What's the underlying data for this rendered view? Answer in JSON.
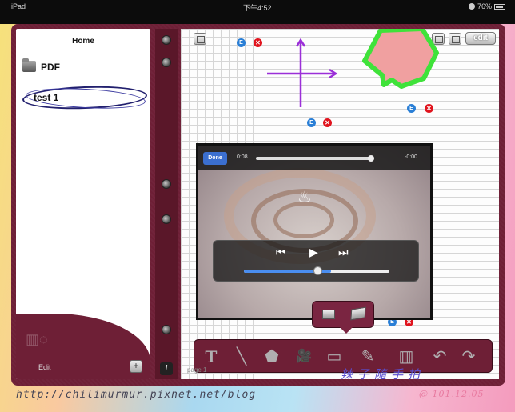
{
  "statusbar": {
    "device": "iPad",
    "time": "下午4:52",
    "battery": "76%"
  },
  "sidebar": {
    "title": "Home",
    "items": [
      {
        "label": "PDF",
        "type": "folder"
      },
      {
        "label": "test 1",
        "type": "document",
        "selected": true
      }
    ],
    "edit_label": "Edit",
    "add_label": "+"
  },
  "spine": {
    "info_label": "i"
  },
  "canvas": {
    "edit_label": "edit",
    "page_label": "page 1",
    "badge_e": "E",
    "badge_x": "✕",
    "shape_colors": {
      "arrow": "#9b2fd8",
      "box_fill": "#f0a0a0",
      "box_stroke": "#3fe23a"
    }
  },
  "video": {
    "done_label": "Done",
    "time_elapsed": "0:08",
    "time_remaining": "-0:00",
    "scrub_progress": 0.97,
    "volume_level": 0.6,
    "prev_icon": "⏮",
    "play_icon": "▶",
    "next_icon": "⏭"
  },
  "toolbar": {
    "tools": [
      "text-tool",
      "line-tool",
      "pentagon-tool",
      "video-tool",
      "rectangle-tool",
      "pen-tool",
      "keyboard-tool",
      "undo-tool",
      "redo-tool"
    ]
  },
  "overlay": {
    "blog_url": "http://chilimurmur.pixnet.net/blog",
    "stamp": "辣子隨手拍",
    "date": "@ 101.12.05"
  }
}
